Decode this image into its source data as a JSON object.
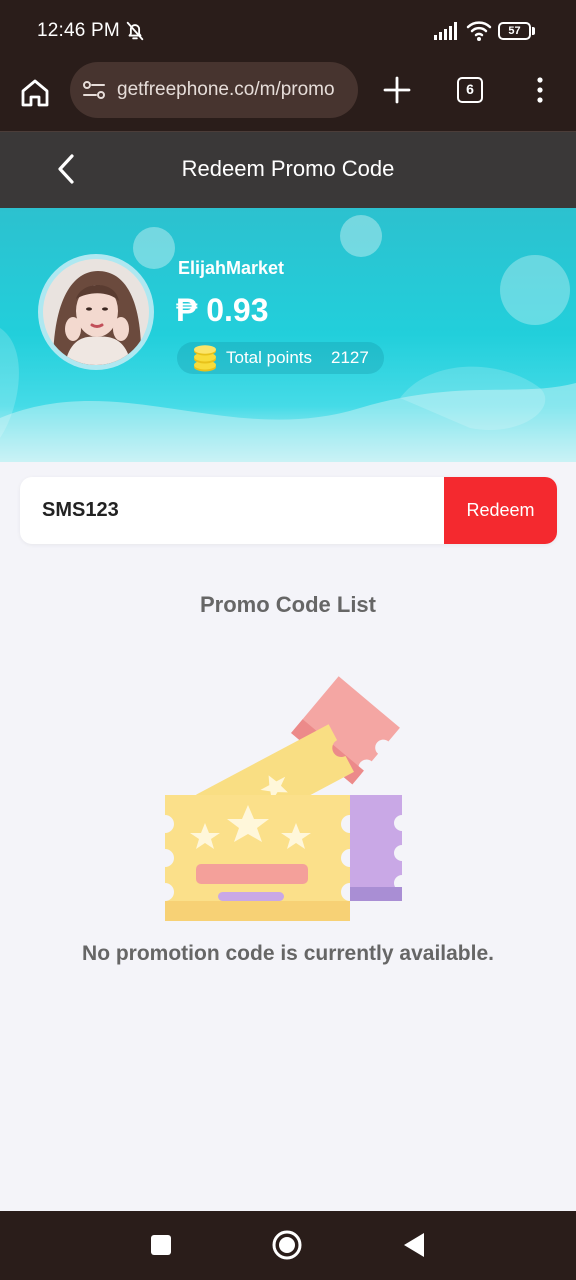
{
  "status_bar": {
    "time": "12:46 PM",
    "battery": "57",
    "icons": [
      "bell-off-icon",
      "signal-icon",
      "wifi-icon",
      "battery-icon"
    ]
  },
  "browser": {
    "url": "getfreephone.co/m/promo",
    "tab_count": "6",
    "icons": [
      "home-icon",
      "site-settings-icon",
      "plus-icon",
      "tabs-icon",
      "more-icon"
    ]
  },
  "header": {
    "title": "Redeem Promo Code"
  },
  "profile": {
    "username": "ElijahMarket",
    "balance": "₱ 0.93",
    "points_label": "Total points",
    "points_value": "2127"
  },
  "promo": {
    "code_value": "SMS123",
    "redeem_label": "Redeem"
  },
  "list": {
    "title": "Promo Code List",
    "empty_message": "No promotion code is currently available."
  },
  "colors": {
    "accent": "#f4292f",
    "hero": "#22cfdb",
    "header_bg": "#3a3838",
    "system_bar": "#2a1d1a"
  }
}
